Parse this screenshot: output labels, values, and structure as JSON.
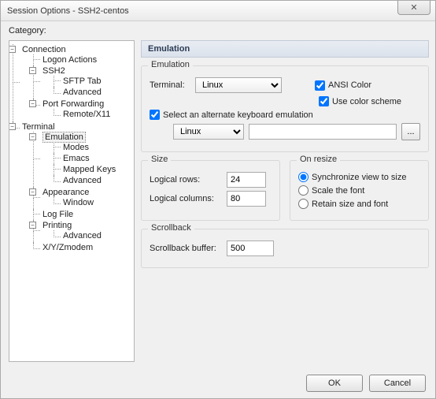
{
  "window": {
    "title": "Session Options - SSH2-centos",
    "close_glyph": "✕"
  },
  "category_label": "Category:",
  "tree": {
    "connection": "Connection",
    "logon_actions": "Logon Actions",
    "ssh2": "SSH2",
    "sftp_tab": "SFTP Tab",
    "ssh2_advanced": "Advanced",
    "port_forwarding": "Port Forwarding",
    "remote_x11": "Remote/X11",
    "terminal": "Terminal",
    "emulation": "Emulation",
    "modes": "Modes",
    "emacs": "Emacs",
    "mapped_keys": "Mapped Keys",
    "emu_advanced": "Advanced",
    "appearance": "Appearance",
    "window": "Window",
    "log_file": "Log File",
    "printing": "Printing",
    "print_advanced": "Advanced",
    "xyzmodem": "X/Y/Zmodem",
    "minus": "−"
  },
  "panel": {
    "heading": "Emulation",
    "emulation": {
      "group_title": "Emulation",
      "terminal_label": "Terminal:",
      "terminal_value": "Linux",
      "ansi_color_label": "ANSI Color",
      "ansi_color_checked": true,
      "use_color_scheme_label": "Use color scheme",
      "use_color_scheme_checked": true,
      "alt_kb_label": "Select an alternate keyboard emulation",
      "alt_kb_checked": true,
      "alt_kb_value": "Linux",
      "alt_kb_path": "",
      "browse_glyph": "..."
    },
    "size": {
      "group_title": "Size",
      "rows_label": "Logical rows:",
      "rows_value": "24",
      "cols_label": "Logical columns:",
      "cols_value": "80"
    },
    "resize": {
      "group_title": "On resize",
      "sync_label": "Synchronize view to size",
      "scale_label": "Scale the font",
      "retain_label": "Retain size and font",
      "selected": "sync"
    },
    "scrollback": {
      "group_title": "Scrollback",
      "buffer_label": "Scrollback buffer:",
      "buffer_value": "500"
    }
  },
  "buttons": {
    "ok": "OK",
    "cancel": "Cancel"
  }
}
